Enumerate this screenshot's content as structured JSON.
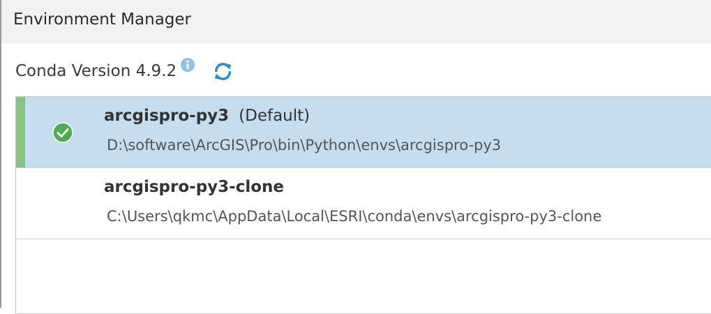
{
  "window": {
    "title": "Environment Manager"
  },
  "conda": {
    "version_label": "Conda Version 4.9.2",
    "info_icon": "info-circle-icon",
    "refresh_icon": "refresh-icon"
  },
  "environments": [
    {
      "name": "arcgispro-py3",
      "default_label": "(Default)",
      "path": "D:\\software\\ArcGIS\\Pro\\bin\\Python\\envs\\arcgispro-py3",
      "active": true,
      "status_icon": "check-circle-icon"
    },
    {
      "name": "arcgispro-py3-clone",
      "default_label": "",
      "path": "C:\\Users\\qkmc\\AppData\\Local\\ESRI\\conda\\envs\\arcgispro-py3-clone",
      "active": false
    }
  ],
  "colors": {
    "selected_row": "#c6dcef",
    "selection_bar": "#86c47f",
    "check_green": "#4caf50",
    "icon_blue": "#2e8bd3"
  }
}
